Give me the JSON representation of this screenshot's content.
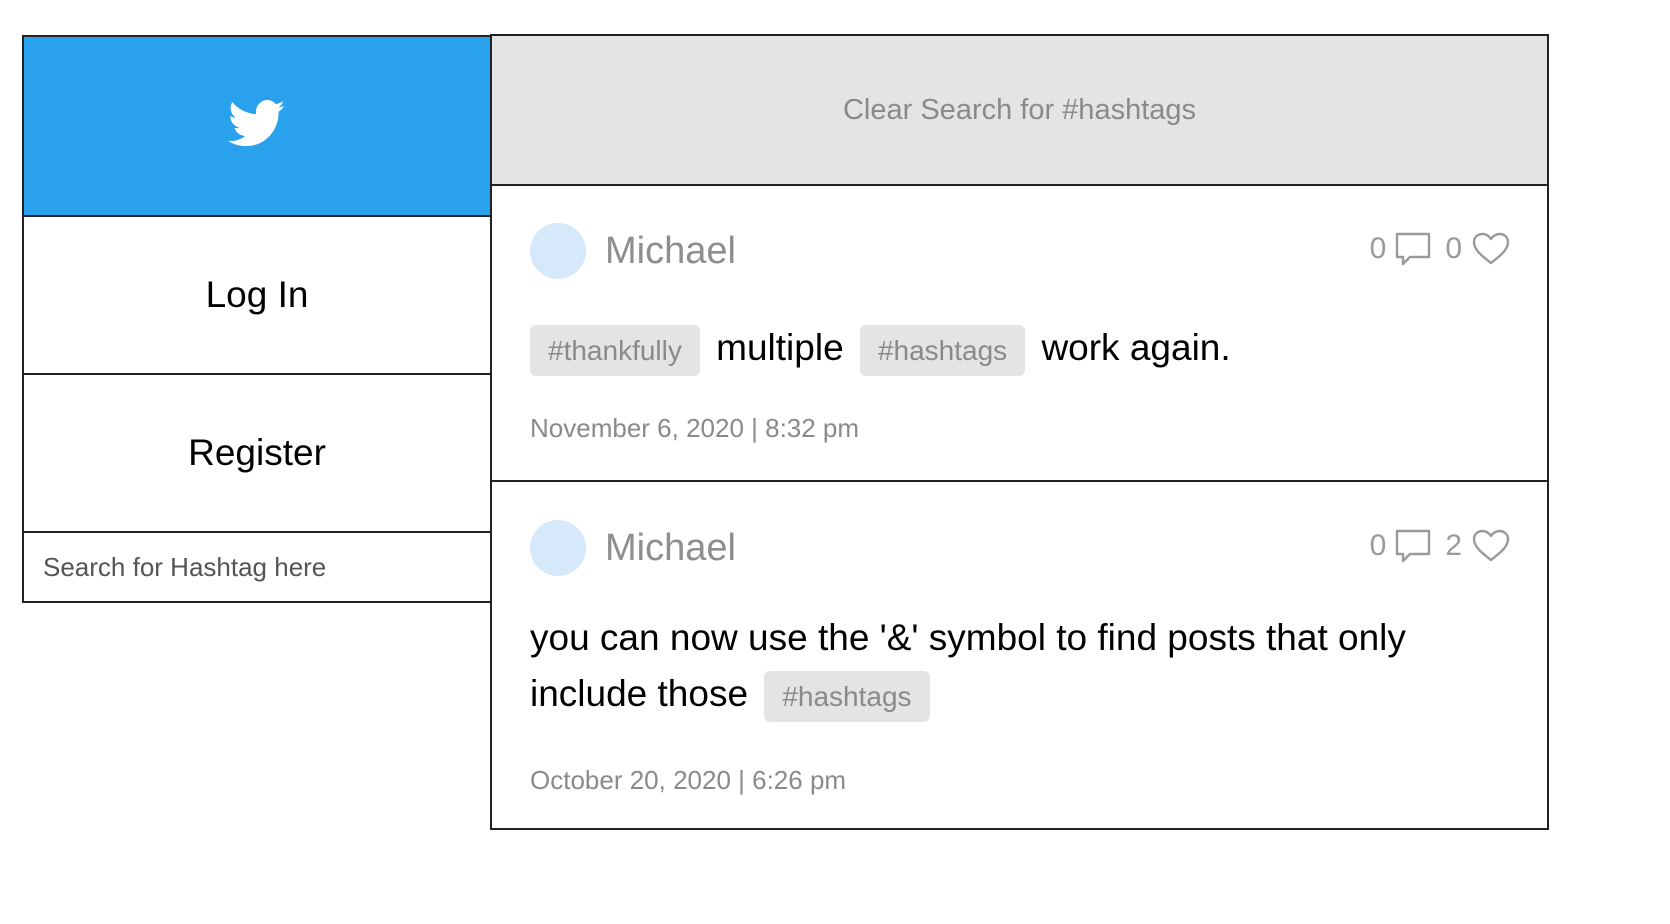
{
  "sidebar": {
    "logo_icon": "twitter-bird-icon",
    "brand_color": "#29a1ed",
    "login_label": "Log In",
    "register_label": "Register",
    "search_placeholder": "Search for Hashtag here"
  },
  "main": {
    "clear_search_label": "Clear Search for #hashtags"
  },
  "posts": [
    {
      "author": "Michael",
      "comments": "0",
      "likes": "0",
      "segments": [
        {
          "type": "tag",
          "text": "#thankfully"
        },
        {
          "type": "text",
          "text": "multiple"
        },
        {
          "type": "tag",
          "text": "#hashtags"
        },
        {
          "type": "text",
          "text": "work again."
        }
      ],
      "date": "November 6, 2020 | 8:32 pm"
    },
    {
      "author": "Michael",
      "comments": "0",
      "likes": "2",
      "segments": [
        {
          "type": "text",
          "text": "you can now use the '&' symbol to find posts that only include those"
        },
        {
          "type": "tag",
          "text": "#hashtags"
        }
      ],
      "date": "October 20, 2020 | 6:26 pm"
    }
  ]
}
